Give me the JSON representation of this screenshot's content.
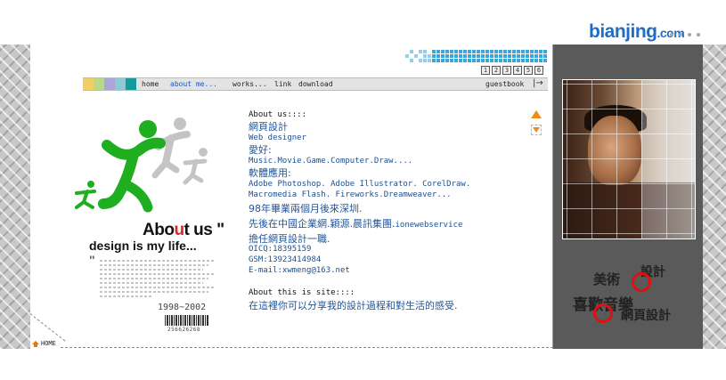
{
  "site_logo": {
    "main": "bianjing",
    "suffix": ".com"
  },
  "page_numbers": [
    "1",
    "2",
    "3",
    "4",
    "5",
    "6"
  ],
  "nav": {
    "swatch_colors": [
      "#f1cf63",
      "#b9d98a",
      "#a9a6d8",
      "#8fc7d3",
      "#129d9a"
    ],
    "items": [
      {
        "label": "home",
        "active": false
      },
      {
        "label": "about me...",
        "active": true
      },
      {
        "label": "works...",
        "active": false
      },
      {
        "label": "link",
        "active": false
      },
      {
        "label": "download",
        "active": false
      },
      {
        "label": "guestbook",
        "active": false
      }
    ],
    "arrow": "|→"
  },
  "artwork": {
    "title_pre": "Abo",
    "title_accent": "u",
    "title_post": "t us \"",
    "subtitle": "design is my life...",
    "quote": "\"",
    "years": "1998~2002",
    "barcode_number": "256626268",
    "colors": {
      "green": "#1fae1f",
      "grey": "#c4c4c4",
      "accent": "#e32222"
    }
  },
  "about": {
    "heading": "About us::::",
    "title_zh": "網頁設計",
    "role": "Web designer",
    "hobby_label": "愛好:",
    "hobbies": "Music.Movie.Game.Computer.Draw....",
    "software_label": "軟體應用:",
    "software_line1": "Adobe Photoshop. Adobe Illustrator. CorelDraw.",
    "software_line2": "Macromedia Flash. Fireworks.Dreamweaver...",
    "history1": "98年畢業兩個月後來深圳.",
    "history2_zh": "先後在中國企業網.穎源.晨訊集團.",
    "history2_en": "ionewebservice",
    "history3": "擔任網頁設計一職.",
    "oicq": "OICQ:18395159",
    "gsm": "GSM:13923414984",
    "email": "E-mail:xwmeng@163.net",
    "site_heading": "About this is site::::",
    "site_desc": "在這裡你可以分享我的設計過程和對生活的感受."
  },
  "home_link": "HOME",
  "tags": {
    "design": "設計",
    "art": "美術",
    "music": "喜歡音樂",
    "web": "網頁設計"
  },
  "colors": {
    "accent_blue": "#1e6fc4",
    "mosaic": "#3aa7dc",
    "arrow_orange": "#ef8a1a",
    "dark_column": "#5a5a5a",
    "ring_red": "#d11111"
  }
}
